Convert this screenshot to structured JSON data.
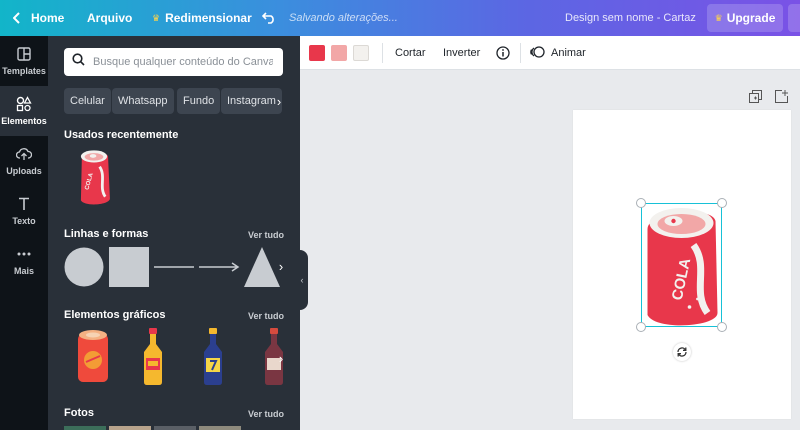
{
  "topbar": {
    "home": "Home",
    "file": "Arquivo",
    "resize": "Redimensionar",
    "saving": "Salvando alterações...",
    "doc_title": "Design sem nome - Cartaz",
    "upgrade": "Upgrade"
  },
  "sidenav": {
    "items": [
      {
        "label": "Templates",
        "icon": "layout-icon"
      },
      {
        "label": "Elementos",
        "icon": "shapes-icon"
      },
      {
        "label": "Uploads",
        "icon": "cloud-upload-icon"
      },
      {
        "label": "Texto",
        "icon": "text-icon"
      },
      {
        "label": "Mais",
        "icon": "more-icon"
      }
    ]
  },
  "panel": {
    "search_placeholder": "Busque qualquer conteúdo do Canva",
    "chips": [
      "Celular",
      "Whatsapp",
      "Fundo",
      "Instagram"
    ],
    "recent_title": "Usados recentemente",
    "lines_title": "Linhas e formas",
    "graphics_title": "Elementos gráficos",
    "photos_title": "Fotos",
    "see_all": "Ver tudo"
  },
  "toolbar": {
    "colors": [
      "#e8374b",
      "#f2a7a7",
      "#f3f1ee"
    ],
    "crop": "Cortar",
    "flip": "Inverter",
    "animate": "Animar"
  },
  "design": {
    "can_text": "COLA"
  }
}
